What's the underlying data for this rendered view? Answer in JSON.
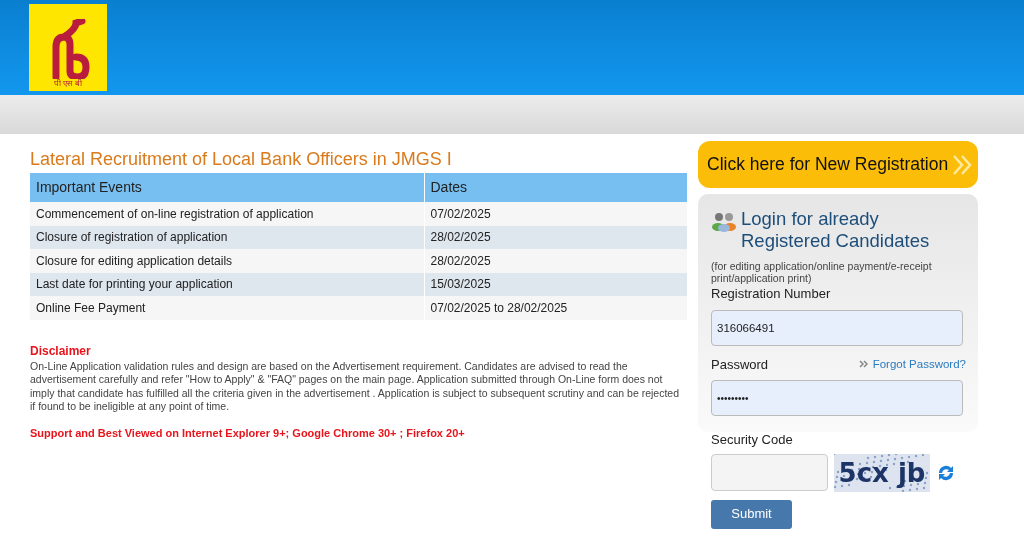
{
  "logo": {
    "caption": "पी एस बी"
  },
  "title": "Lateral Recruitment of Local Bank Officers in JMGS I",
  "table": {
    "columns": [
      "Important Events",
      "Dates"
    ],
    "rows": [
      [
        "Commencement of on-line registration of application",
        "07/02/2025"
      ],
      [
        "Closure of registration of application",
        "28/02/2025"
      ],
      [
        "Closure for editing application details",
        "28/02/2025"
      ],
      [
        "Last date for printing your application",
        "15/03/2025"
      ],
      [
        "Online Fee Payment",
        "07/02/2025 to 28/02/2025"
      ]
    ]
  },
  "disclaimer": {
    "heading": "Disclaimer",
    "text": "On-Line Application validation rules and design are based on the Advertisement requirement. Candidates are advised to read the advertisement carefully and refer \"How to Apply\" & \"FAQ\" pages on the main page. Application submitted through On-Line form does not imply that candidate has fulfilled all the criteria given in the advertisement . Application is subject to subsequent scrutiny and can be rejected if found to be ineligible at any point of time."
  },
  "browser_note": "Support and Best Viewed on Internet Explorer 9+; Google Chrome 30+ ; Firefox 20+",
  "new_registration": "Click here for New Registration",
  "login": {
    "title": "Login for already Registered Candidates",
    "note": "(for editing application/online payment/e-receipt print/application print)",
    "registration_label": "Registration Number",
    "registration_value": "316066491",
    "password_label": "Password",
    "forgot": "Forgot Password?",
    "password_value": "•••••••••",
    "security_label": "Security Code",
    "captcha": "5cx jb",
    "submit": "Submit"
  }
}
